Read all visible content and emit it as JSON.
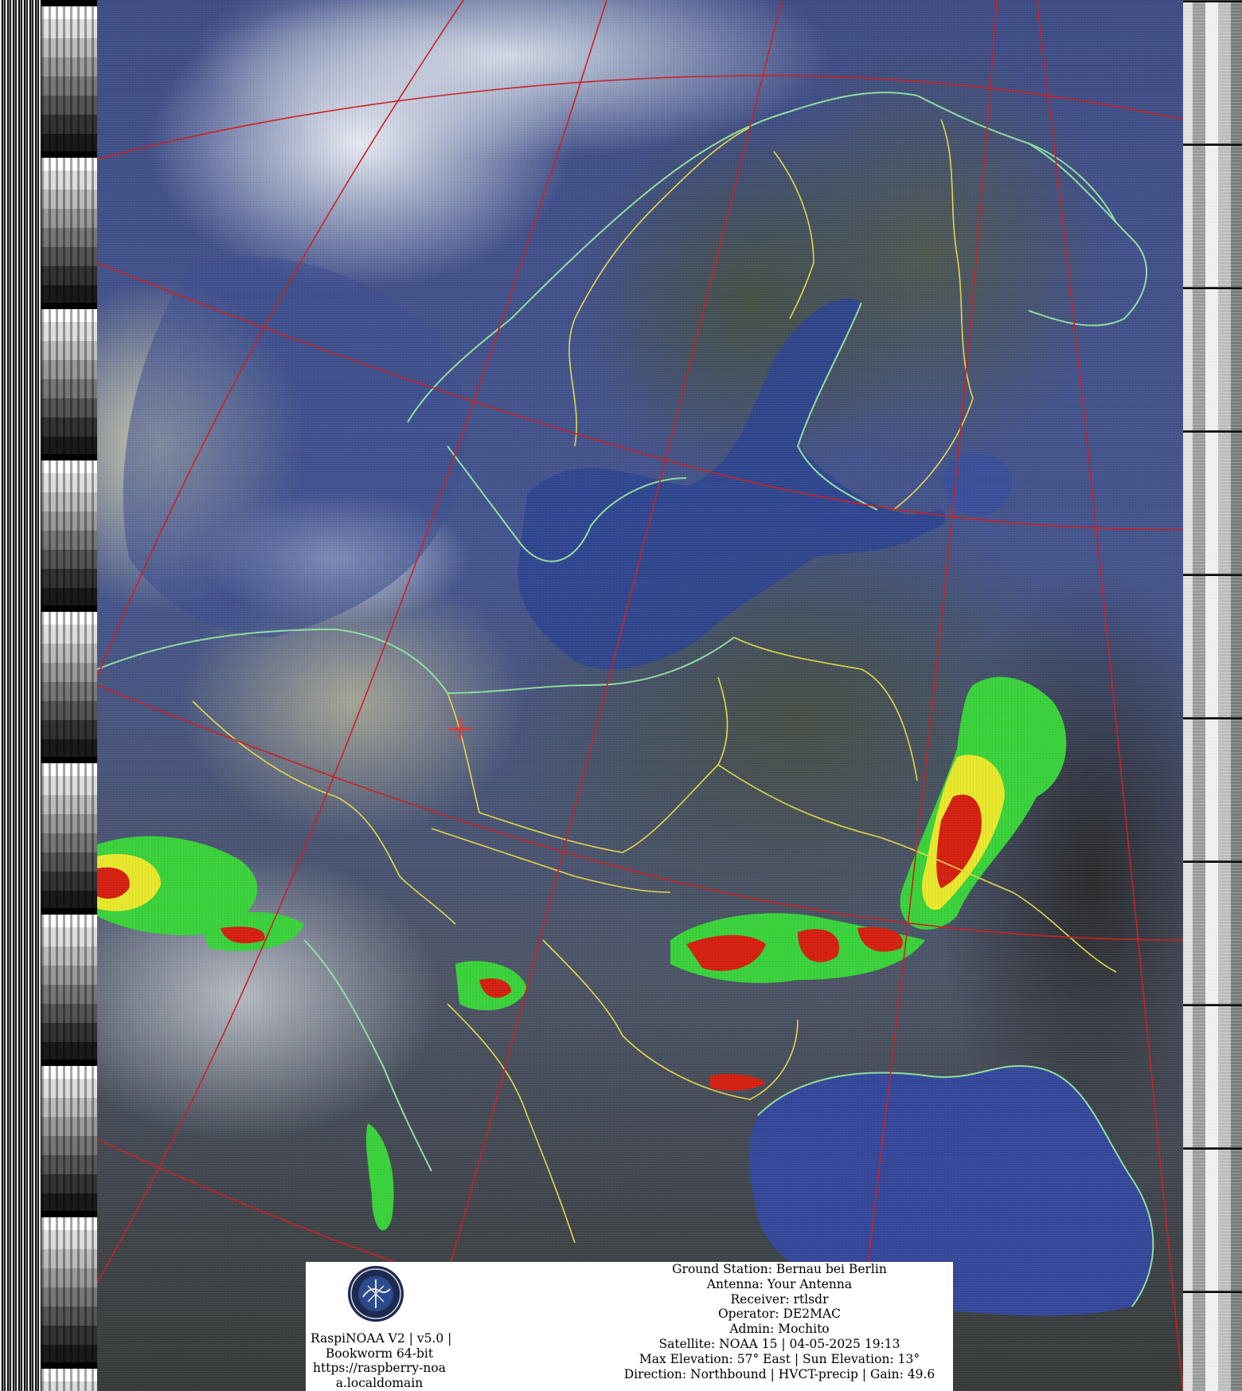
{
  "image": {
    "subject": "NOAA 15 APT satellite image of northern and eastern Europe with map overlay and precipitation colouring",
    "colors": {
      "graticule": "#cc1f1f",
      "borders": "#e6d84a",
      "coastline": "#8fe0a0",
      "ground_station_marker": "#e23a3a",
      "precip_light": "#39d23a",
      "precip_medium": "#e8e82a",
      "precip_heavy": "#d51f0f",
      "overlay_background": "#ffffff"
    }
  },
  "logo": {
    "icon": "satellite-station-emblem-icon"
  },
  "station": {
    "software": "RaspiNOAA V2 | v5.0 |",
    "os": "Bookworm 64-bit",
    "url": "https://raspberry-noaa.localdomain"
  },
  "pass": {
    "ground_station": "Ground Station: Bernau bei Berlin",
    "antenna": "Antenna: Your Antenna",
    "receiver": "Receiver: rtlsdr",
    "operator": "Operator: DE2MAC",
    "admin": "Admin: Mochito",
    "satellite": "Satellite: NOAA 15 | 04-05-2025 19:13",
    "elevation": "Max Elevation: 57° East | Sun Elevation: 13°",
    "direction": "Direction: Northbound | HVCT-precip | Gain: 49.6"
  }
}
